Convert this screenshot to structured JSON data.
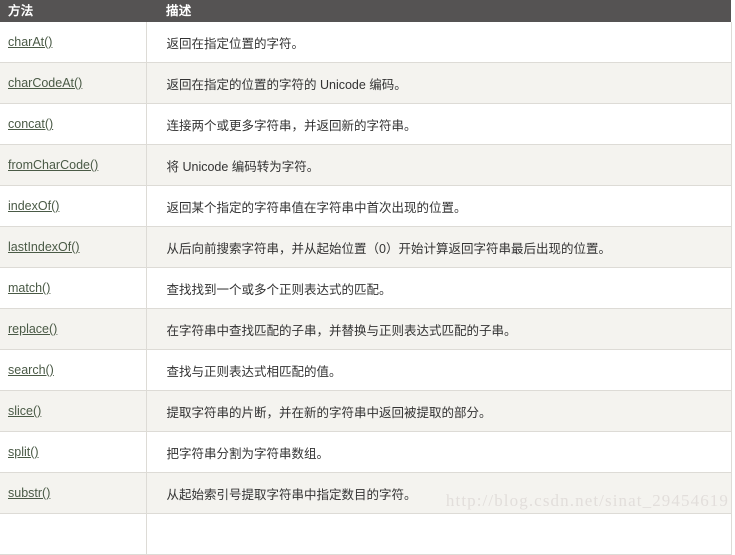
{
  "table": {
    "headers": {
      "method": "方法",
      "description": "描述"
    },
    "rows": [
      {
        "method": "charAt()",
        "description": "返回在指定位置的字符。"
      },
      {
        "method": "charCodeAt()",
        "description": "返回在指定的位置的字符的 Unicode 编码。"
      },
      {
        "method": "concat()",
        "description": "连接两个或更多字符串，并返回新的字符串。"
      },
      {
        "method": "fromCharCode()",
        "description": "将 Unicode 编码转为字符。"
      },
      {
        "method": "indexOf()",
        "description": "返回某个指定的字符串值在字符串中首次出现的位置。"
      },
      {
        "method": "lastIndexOf()",
        "description": "从后向前搜索字符串，并从起始位置（0）开始计算返回字符串最后出现的位置。"
      },
      {
        "method": "match()",
        "description": "查找找到一个或多个正则表达式的匹配。"
      },
      {
        "method": "replace()",
        "description": "在字符串中查找匹配的子串，并替换与正则表达式匹配的子串。"
      },
      {
        "method": "search()",
        "description": "查找与正则表达式相匹配的值。"
      },
      {
        "method": "slice()",
        "description": "提取字符串的片断，并在新的字符串中返回被提取的部分。"
      },
      {
        "method": "split()",
        "description": "把字符串分割为字符串数组。"
      },
      {
        "method": "substr()",
        "description": "从起始索引号提取字符串中指定数目的字符。"
      },
      {
        "method": "",
        "description": ""
      }
    ]
  },
  "watermark": {
    "text": "http://blog.csdn.net/sinat_29454619"
  },
  "colors": {
    "header_background": "#555353",
    "header_text": "#ffffff",
    "row_odd": "#ffffff",
    "row_even": "#f4f3ef",
    "border": "#dddbd6",
    "link": "#4a5a46",
    "body_text": "#333333",
    "watermark": "#e2dedb"
  }
}
